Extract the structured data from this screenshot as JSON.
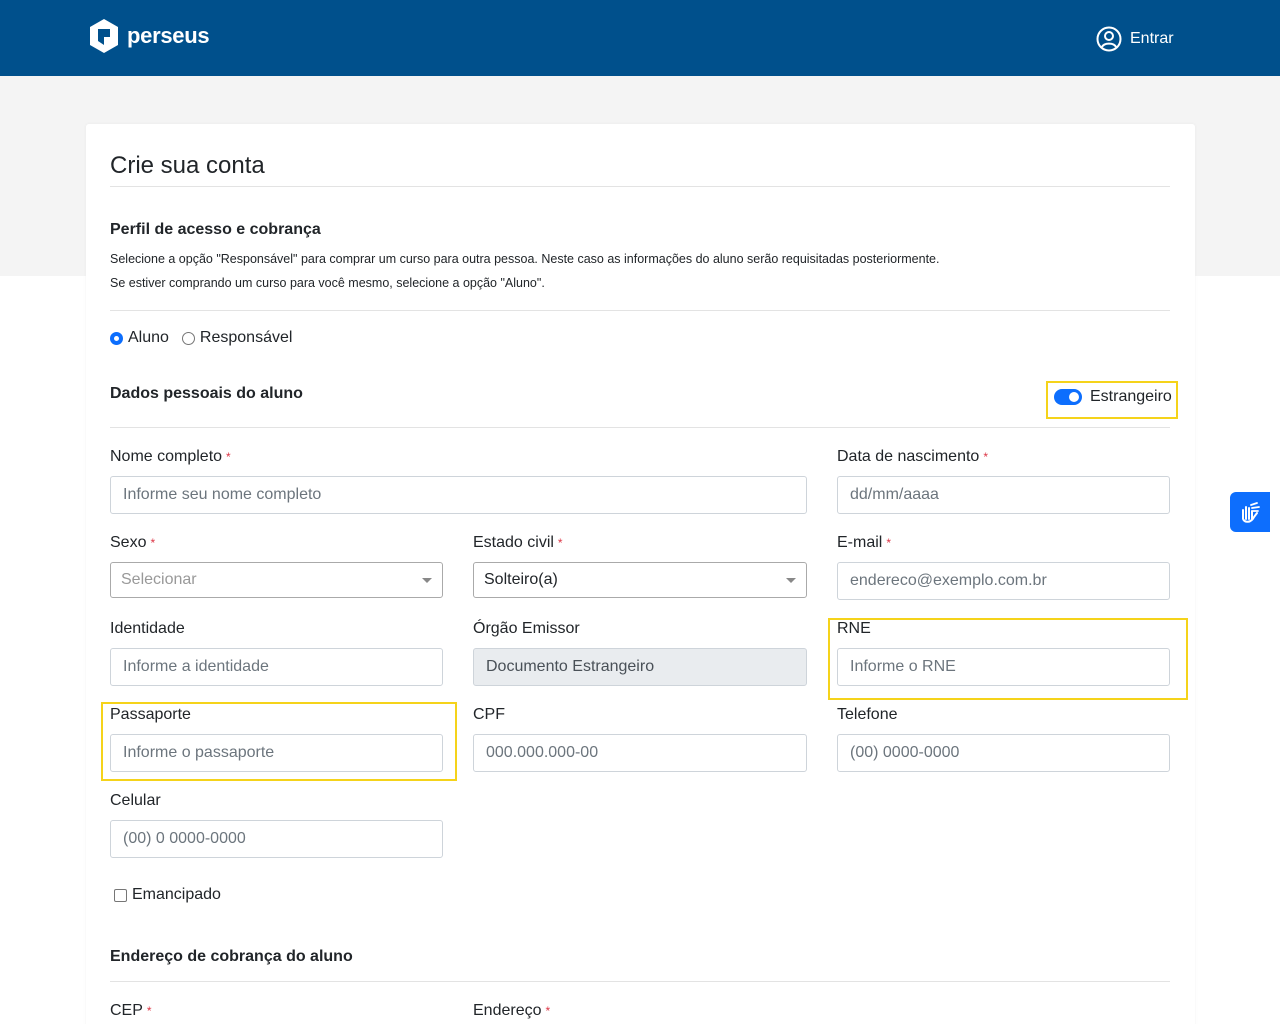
{
  "header": {
    "brand": "perseus",
    "login_label": "Entrar",
    "bg_color": "#00508c"
  },
  "form": {
    "title": "Crie sua conta",
    "profile_section": {
      "title": "Perfil de acesso e cobrança",
      "help_line1": "Selecione a opção \"Responsável\" para comprar um curso para outra pessoa. Neste caso as informações do aluno serão requisitadas posteriormente.",
      "help_line2": "Se estiver comprando um curso para você mesmo, selecione a opção \"Aluno\".",
      "options": [
        {
          "label": "Aluno",
          "selected": true
        },
        {
          "label": "Responsável",
          "selected": false
        }
      ]
    },
    "personal_section": {
      "title": "Dados pessoais do aluno",
      "foreigner_toggle": {
        "label": "Estrangeiro",
        "on": true
      }
    },
    "fields": {
      "full_name": {
        "label": "Nome completo",
        "placeholder": "Informe seu nome completo",
        "required": "*"
      },
      "birth_date": {
        "label": "Data de nascimento",
        "placeholder": "dd/mm/aaaa",
        "required": "*"
      },
      "sex": {
        "label": "Sexo",
        "value": "Selecionar",
        "required": "*"
      },
      "marital_status": {
        "label": "Estado civil",
        "value": "Solteiro(a)",
        "required": "*"
      },
      "email": {
        "label": "E-mail",
        "placeholder": "endereco@exemplo.com.br",
        "required": "*"
      },
      "identity": {
        "label": "Identidade",
        "placeholder": "Informe a identidade"
      },
      "issuer": {
        "label": "Órgão Emissor",
        "value": "Documento Estrangeiro"
      },
      "rne": {
        "label": "RNE",
        "placeholder": "Informe o RNE"
      },
      "passport": {
        "label": "Passaporte",
        "placeholder": "Informe o passaporte"
      },
      "cpf": {
        "label": "CPF",
        "placeholder": "000.000.000-00"
      },
      "phone": {
        "label": "Telefone",
        "placeholder": "(00) 0000-0000"
      },
      "mobile": {
        "label": "Celular",
        "placeholder": "(00) 0 0000-0000"
      }
    },
    "emancipated": {
      "label": "Emancipado",
      "checked": false
    },
    "billing_section": {
      "title": "Endereço de cobrança do aluno",
      "cep_label": "CEP",
      "address_label": "Endereço",
      "required": "*"
    }
  },
  "accessibility": {
    "icon": "sign-language-hands-icon",
    "color": "#0d6efd"
  },
  "colors": {
    "highlight": "#f5d31a",
    "accent": "#0d6efd",
    "required": "#dc3545"
  }
}
